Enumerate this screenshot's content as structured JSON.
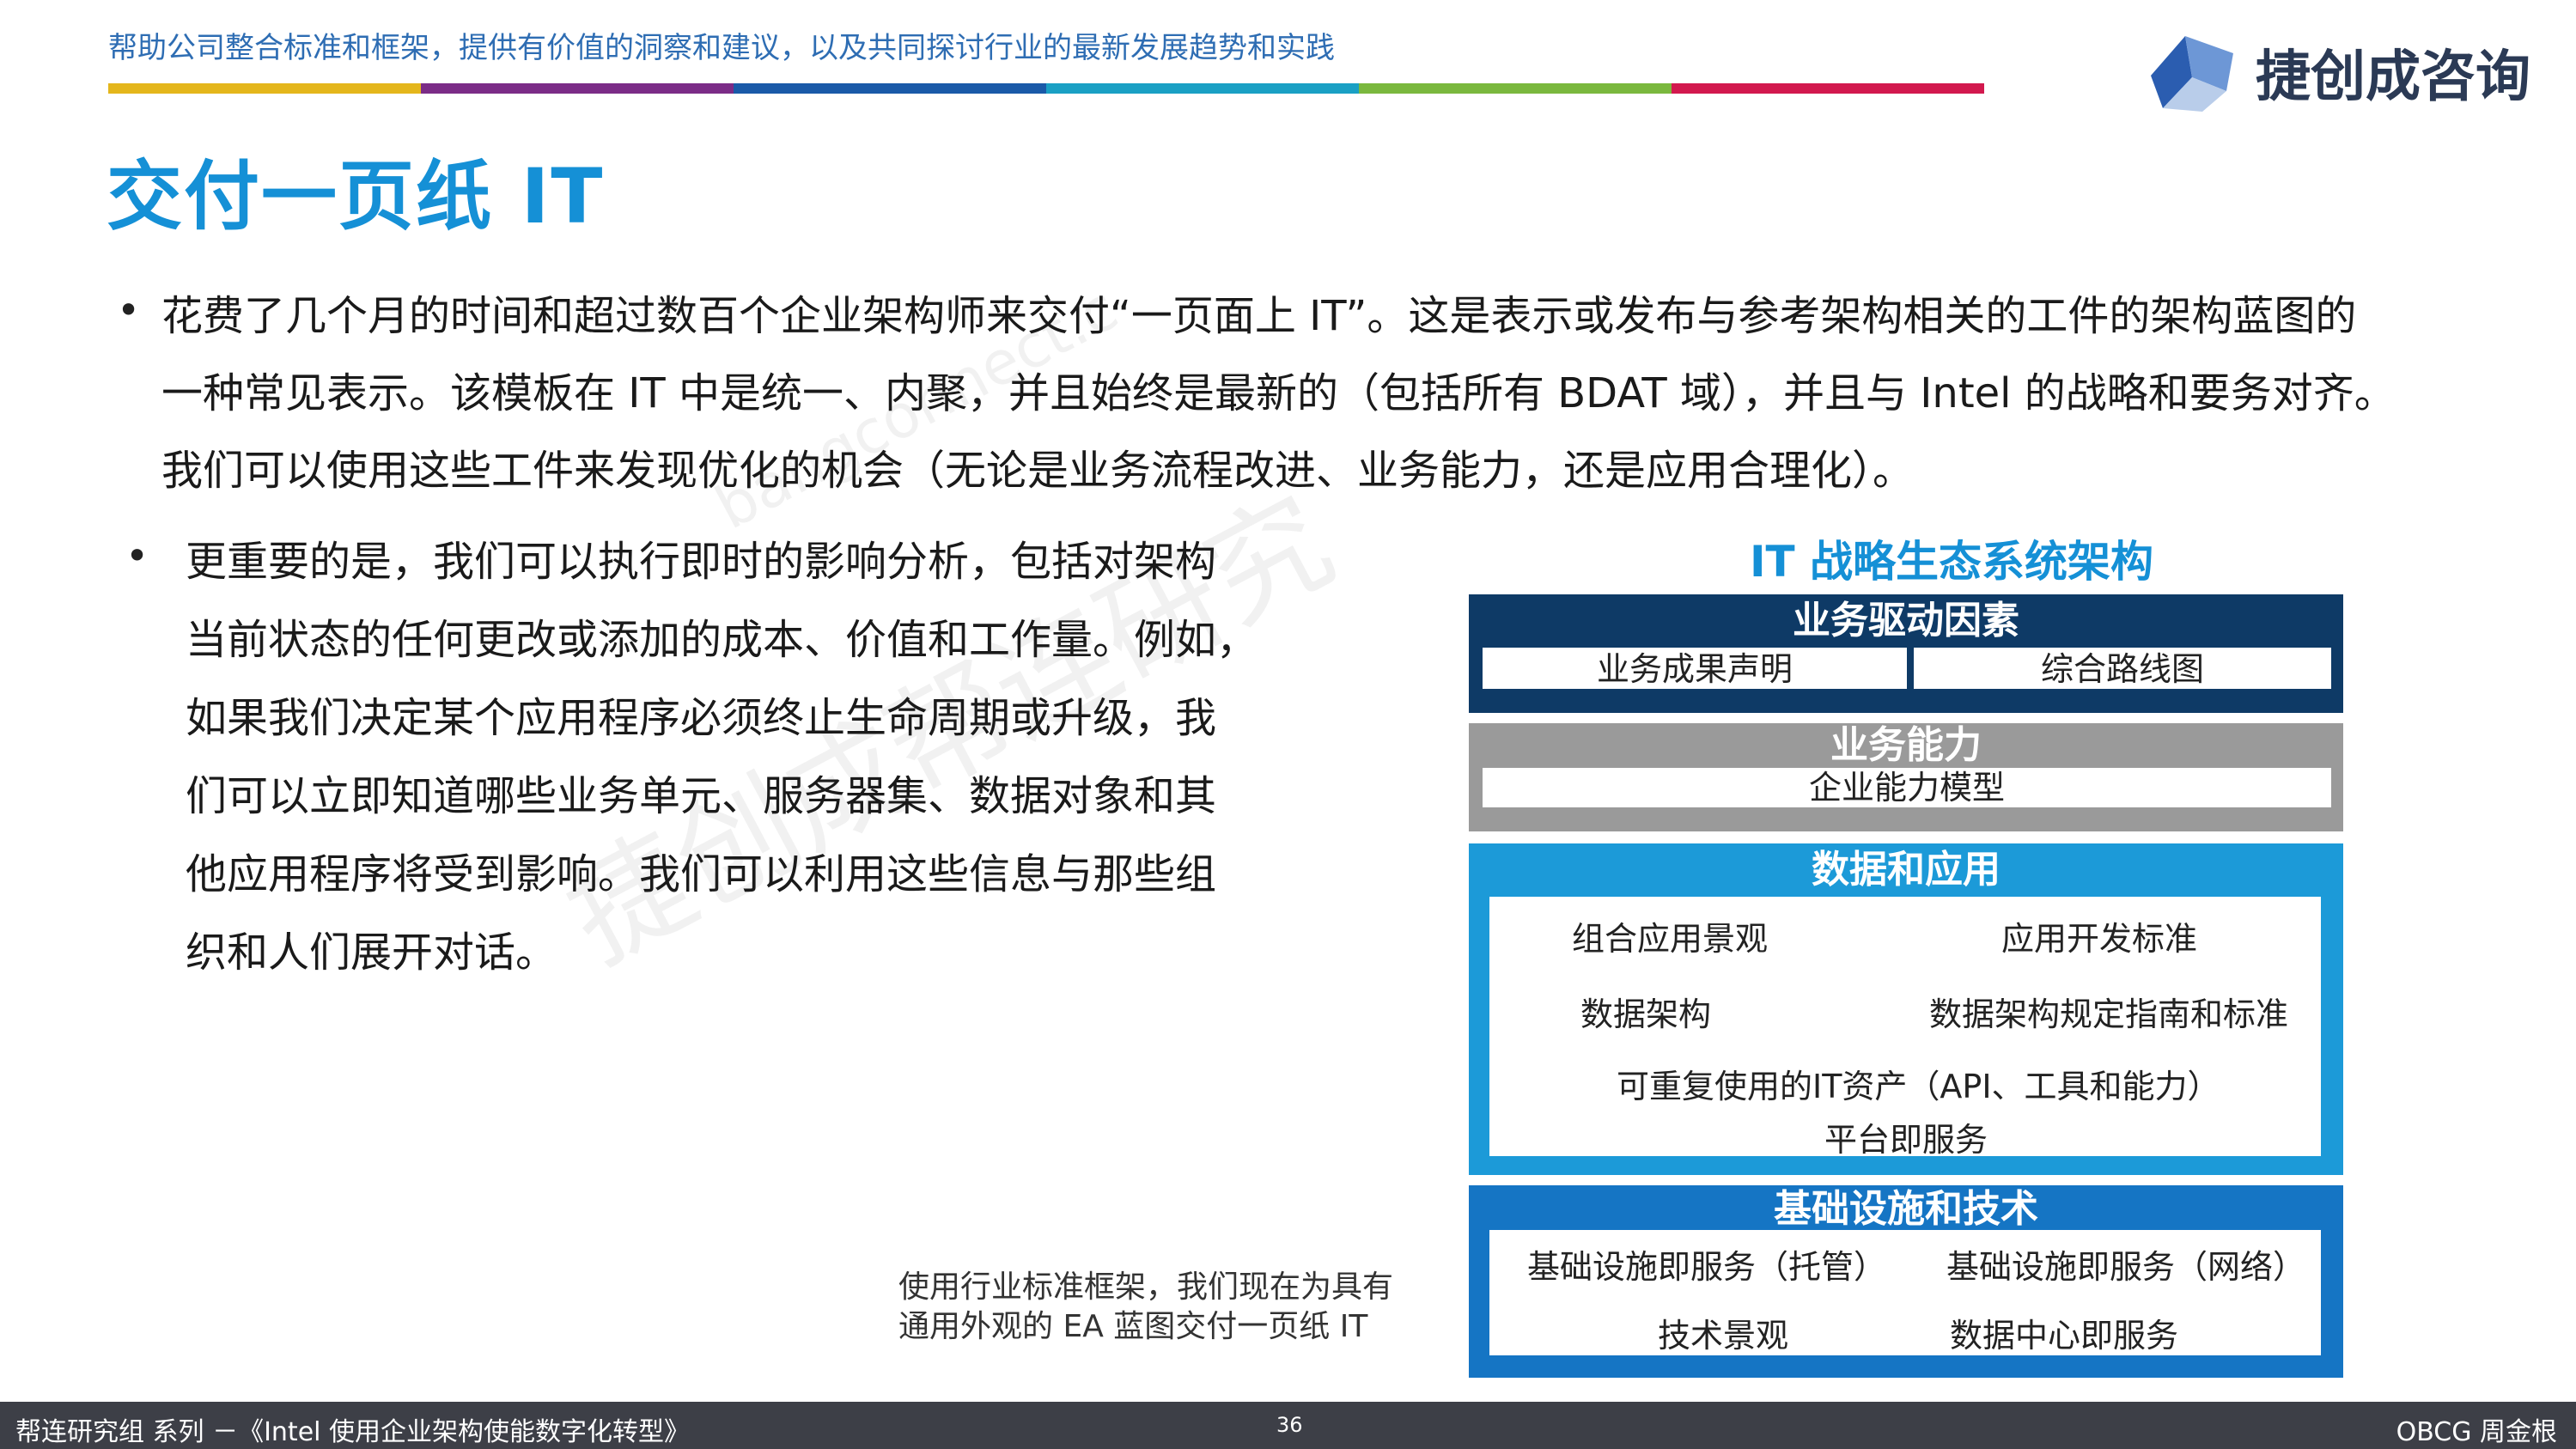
{
  "header": {
    "tagline": "帮助公司整合标准和框架，提供有价值的洞察和建议，以及共同探讨行业的最新发展趋势和实践",
    "color_bar": [
      "#e4b61c",
      "#7b2c87",
      "#1a5aa8",
      "#1aa0c4",
      "#7ab83e",
      "#d2194e"
    ],
    "logo_text": "捷创成咨询",
    "logo_colors": [
      "#2b5db0",
      "#6d97d6",
      "#b9cdea"
    ]
  },
  "title": "交付一页纸 IT",
  "paragraph1": {
    "lines": [
      "花费了几个月的时间和超过数百个企业架构师来交付“一页面上 IT”。这是表示或发布与参考架构相关的工件的架构蓝图的",
      "一种常见表示。该模板在 IT 中是统一、内聚，并且始终是最新的（包括所有 BDAT 域），并且与 Intel 的战略和要务对齐。",
      "我们可以使用这些工件来发现优化的机会（无论是业务流程改进、业务能力，还是应用合理化）。"
    ]
  },
  "paragraph2": {
    "lines": [
      "更重要的是，我们可以执行即时的影响分析，包括对架构",
      "当前状态的任何更改或添加的成本、价值和工作量。例如，",
      "如果我们决定某个应用程序必须终止生命周期或升级，我",
      "们可以立即知道哪些业务单元、服务器集、数据对象和其",
      "他应用程序将受到影响。我们可以利用这些信息与那些组",
      "织和人们展开对话。"
    ]
  },
  "bullet_glyph": "•",
  "caption": {
    "lines": [
      "使用行业标准框架，我们现在为具有",
      "通用外观的 EA 蓝图交付一页纸 IT"
    ]
  },
  "diagram": {
    "title": "IT 战略生态系统架构",
    "colors": {
      "layer1": "#0e3a66",
      "layer2": "#9a9a9a",
      "layer3": "#1c9ad8",
      "layer4": "#1575c4"
    },
    "layer1": {
      "heading": "业务驱动因素",
      "items": [
        "业务成果声明",
        "综合路线图"
      ]
    },
    "layer2": {
      "heading": "业务能力",
      "items": [
        "企业能力模型"
      ]
    },
    "layer3": {
      "heading": "数据和应用",
      "items": [
        "组合应用景观",
        "应用开发标准",
        "数据架构",
        "数据架构规定指南和标准",
        "可重复使用的IT资产（API、工具和能力）",
        "平台即服务"
      ]
    },
    "layer4": {
      "heading": "基础设施和技术",
      "items": [
        "基础设施即服务（托管）",
        "基础设施即服务（网络）",
        "技术景观",
        "数据中心即服务"
      ]
    }
  },
  "footer": {
    "left": "帮连研究组 系列  －《Intel 使用企业架构使能数字化转型》",
    "page": "36",
    "right": "OBCG 周金根"
  },
  "watermark": {
    "text_main": "捷创成帮连研究",
    "text_url": "bangconnect.c"
  }
}
